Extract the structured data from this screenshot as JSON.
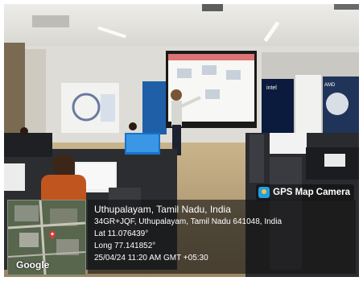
{
  "overlay": {
    "app_label": "GPS Map Camera",
    "map_brand": "Google",
    "location_title": "Uthupalayam, Tamil Nadu, India",
    "address": "34GR+JQF, Uthupalayam, Tamil Nadu 641048, India",
    "lat": "Lat 11.076439°",
    "long": "Long 77.141852°",
    "datetime": "25/04/24 11:20 AM GMT +05:30"
  },
  "projection": {
    "badges": [
      "intel",
      "AMD"
    ]
  },
  "icons": {
    "app": "camera-icon",
    "map_pin": "map-pin-icon"
  },
  "colors": {
    "app_icon": "#1ea0e8",
    "map_pin": "#e53935"
  }
}
